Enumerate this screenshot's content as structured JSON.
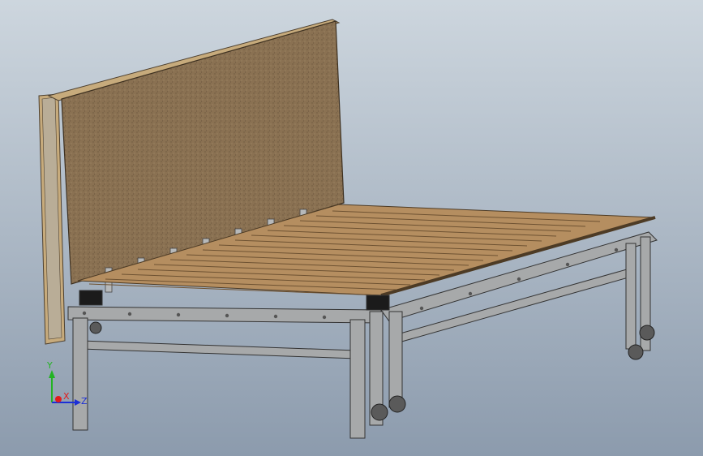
{
  "viewport": {
    "background_top": "#cdd6de",
    "background_bottom": "#8c9bad"
  },
  "model": {
    "board_color": "#8a7152",
    "slat_color": "#c19a6b",
    "frame_color": "#a7a9aa",
    "wheel_color": "#5a5a5a"
  },
  "triad": {
    "x_label": "X",
    "y_label": "Y",
    "z_label": "Z",
    "x_color": "#e21b1b",
    "y_color": "#23b323",
    "z_color": "#1c2fd6"
  }
}
